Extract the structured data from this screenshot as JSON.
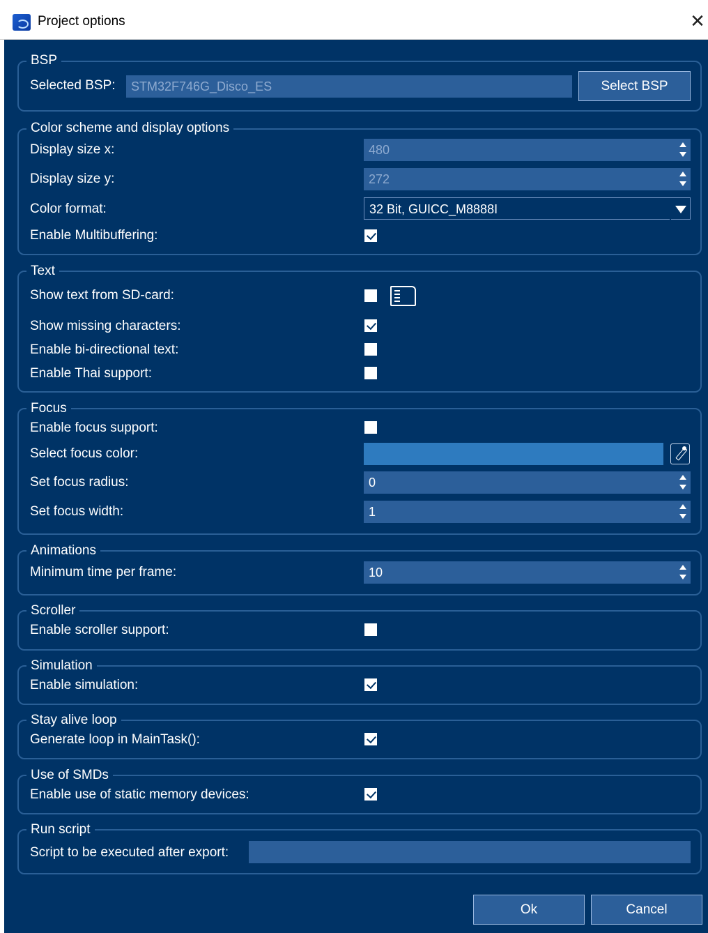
{
  "window": {
    "title": "Project options"
  },
  "bsp": {
    "group_title": "BSP",
    "selected_label": "Selected BSP:",
    "selected_value": "STM32F746G_Disco_ES",
    "select_button": "Select BSP"
  },
  "display": {
    "group_title": "Color scheme and display options",
    "size_x_label": "Display size x:",
    "size_x_value": "480",
    "size_y_label": "Display size y:",
    "size_y_value": "272",
    "color_format_label": "Color format:",
    "color_format_value": "32 Bit, GUICC_M8888I",
    "multibuffer_label": "Enable Multibuffering:",
    "multibuffer_checked": true
  },
  "text": {
    "group_title": "Text",
    "sd_label": "Show text from SD-card:",
    "sd_checked": false,
    "missing_label": "Show missing characters:",
    "missing_checked": true,
    "bidi_label": "Enable bi-directional text:",
    "bidi_checked": false,
    "thai_label": "Enable Thai support:",
    "thai_checked": false
  },
  "focus": {
    "group_title": "Focus",
    "support_label": "Enable focus support:",
    "support_checked": false,
    "color_label": "Select focus color:",
    "focus_color": "#2e7bbf",
    "radius_label": "Set focus radius:",
    "radius_value": "0",
    "width_label": "Set focus width:",
    "width_value": "1"
  },
  "animations": {
    "group_title": "Animations",
    "min_time_label": "Minimum time per frame:",
    "min_time_value": "10"
  },
  "scroller": {
    "group_title": "Scroller",
    "support_label": "Enable scroller support:",
    "support_checked": false
  },
  "simulation": {
    "group_title": "Simulation",
    "enable_label": "Enable simulation:",
    "enable_checked": true
  },
  "stay_alive": {
    "group_title": "Stay alive loop",
    "generate_label": "Generate loop in MainTask():",
    "generate_checked": true
  },
  "smd": {
    "group_title": "Use of SMDs",
    "enable_label": "Enable use of static memory devices:",
    "enable_checked": true
  },
  "run_script": {
    "group_title": "Run script",
    "script_label": "Script to be executed after export:",
    "script_value": ""
  },
  "footer": {
    "ok_label": "Ok",
    "cancel_label": "Cancel"
  },
  "colors": {
    "background": "#003366",
    "field": "#2c5f9a",
    "border": "#2a5f96"
  }
}
